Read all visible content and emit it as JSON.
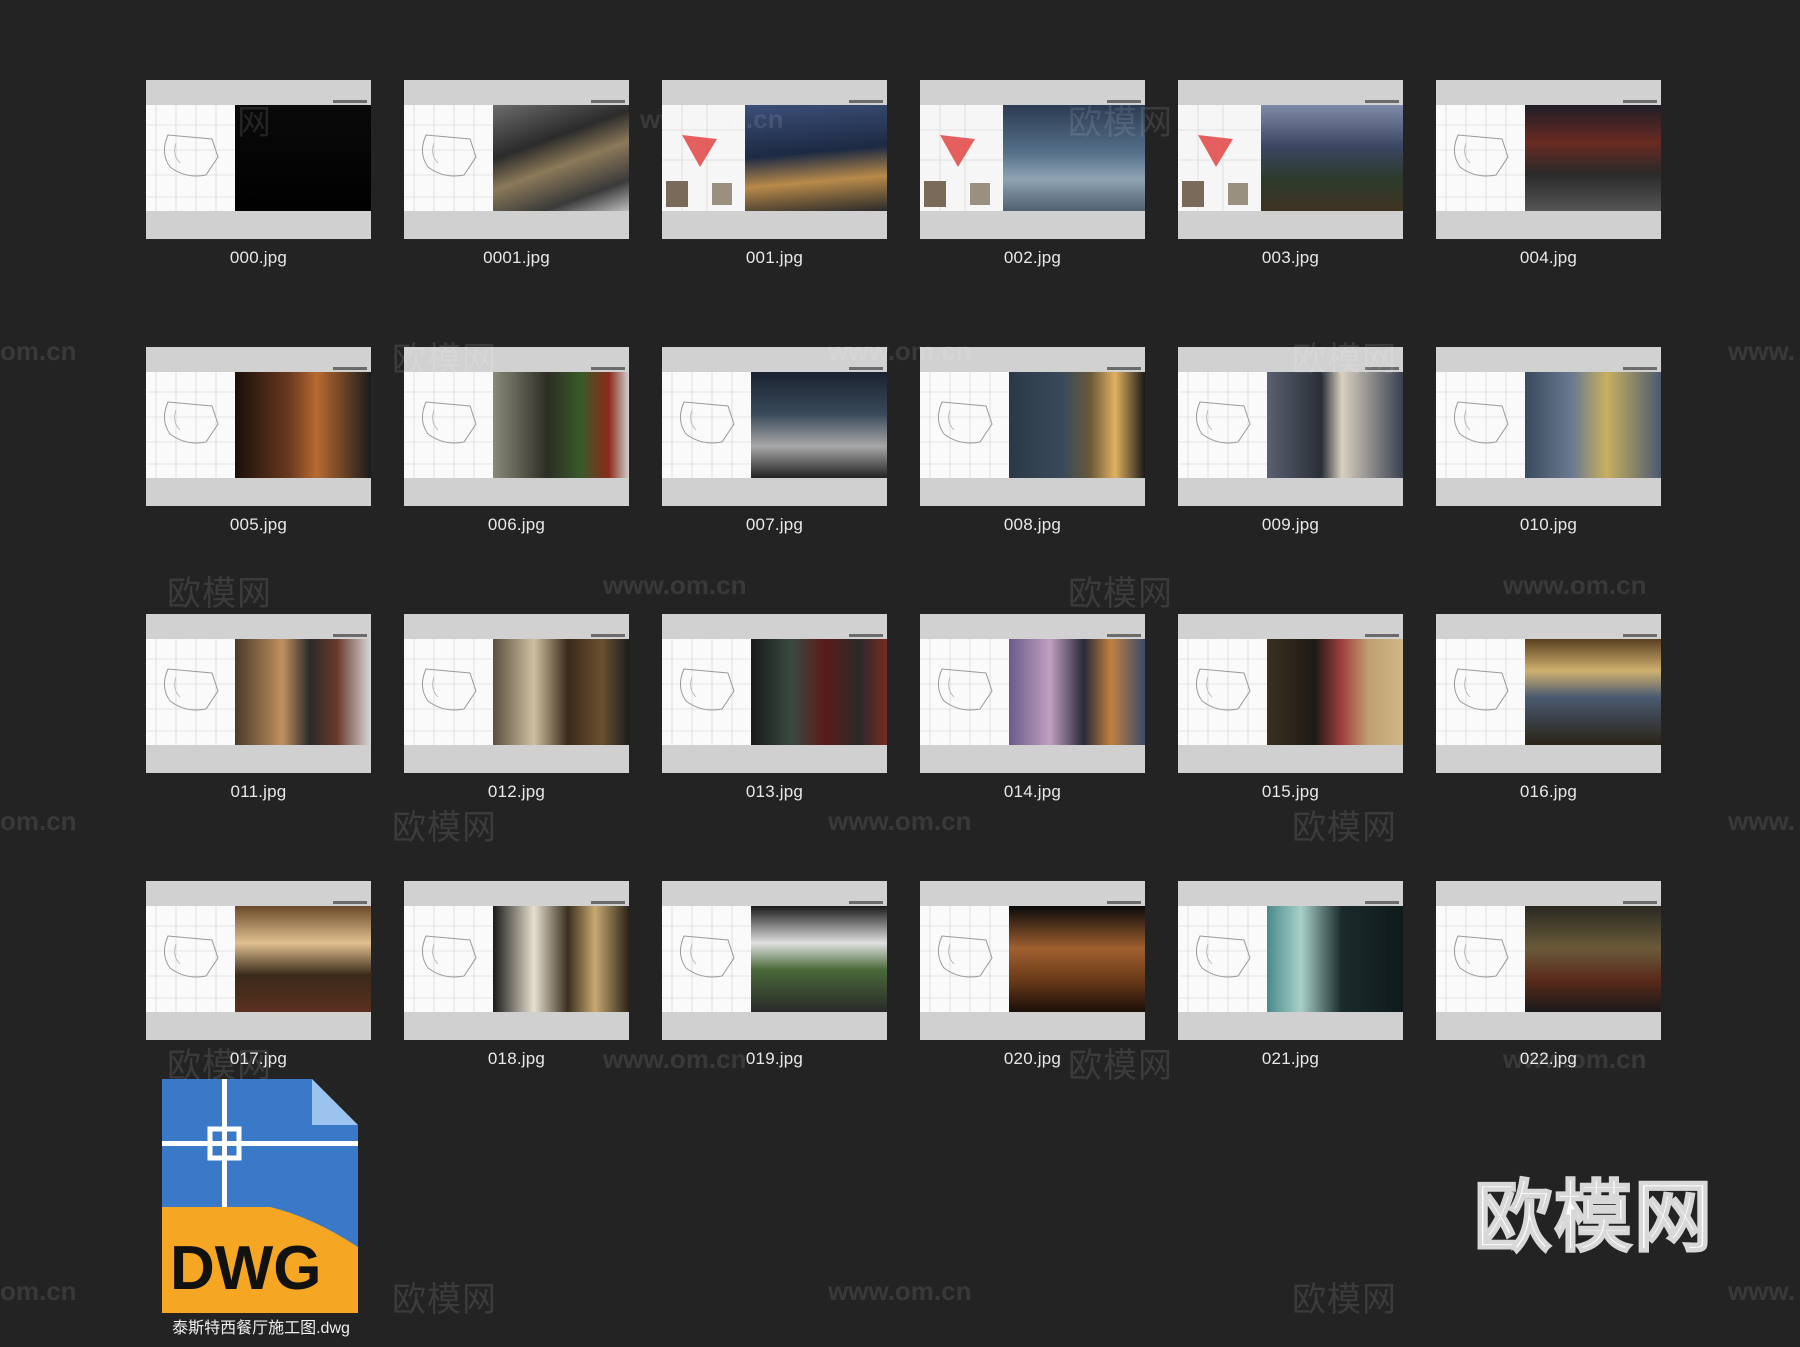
{
  "files": [
    {
      "name": "000.jpg",
      "photo": "dark-text"
    },
    {
      "name": "0001.jpg",
      "photo": "exterior-1"
    },
    {
      "name": "001.jpg",
      "photo": "exterior-2",
      "split": true
    },
    {
      "name": "002.jpg",
      "photo": "exterior-3",
      "split": true
    },
    {
      "name": "003.jpg",
      "photo": "interior-blue",
      "split": true
    },
    {
      "name": "004.jpg",
      "photo": "storefront"
    },
    {
      "name": "005.jpg",
      "photo": "bar-red"
    },
    {
      "name": "006.jpg",
      "photo": "window-plants"
    },
    {
      "name": "007.jpg",
      "photo": "dining-white"
    },
    {
      "name": "008.jpg",
      "photo": "lamps-gold"
    },
    {
      "name": "009.jpg",
      "photo": "curtain-gray"
    },
    {
      "name": "010.jpg",
      "photo": "curtain-blue"
    },
    {
      "name": "011.jpg",
      "photo": "warm-hall"
    },
    {
      "name": "012.jpg",
      "photo": "arc-ceiling"
    },
    {
      "name": "013.jpg",
      "photo": "red-panels"
    },
    {
      "name": "014.jpg",
      "photo": "corridor-purple"
    },
    {
      "name": "015.jpg",
      "photo": "wood-wall"
    },
    {
      "name": "016.jpg",
      "photo": "long-bar"
    },
    {
      "name": "017.jpg",
      "photo": "bar-counter"
    },
    {
      "name": "018.jpg",
      "photo": "frames-wall"
    },
    {
      "name": "019.jpg",
      "photo": "dining-wide"
    },
    {
      "name": "020.jpg",
      "photo": "amber-room"
    },
    {
      "name": "021.jpg",
      "photo": "teal-door"
    },
    {
      "name": "022.jpg",
      "photo": "dark-lounge"
    }
  ],
  "dwg_file": {
    "badge": "DWG",
    "name": "泰斯特西餐厅施工图.dwg",
    "icon": "autocad-dwg-file-icon",
    "colors": {
      "blue": "#3a78c8",
      "orange": "#f5a623",
      "corner": "#8fb8e8"
    }
  },
  "watermark": {
    "cn": "欧模网",
    "url": "www.om.cn",
    "url_short": "om.cn",
    "url_prefix": "www."
  },
  "brand": "欧模网"
}
